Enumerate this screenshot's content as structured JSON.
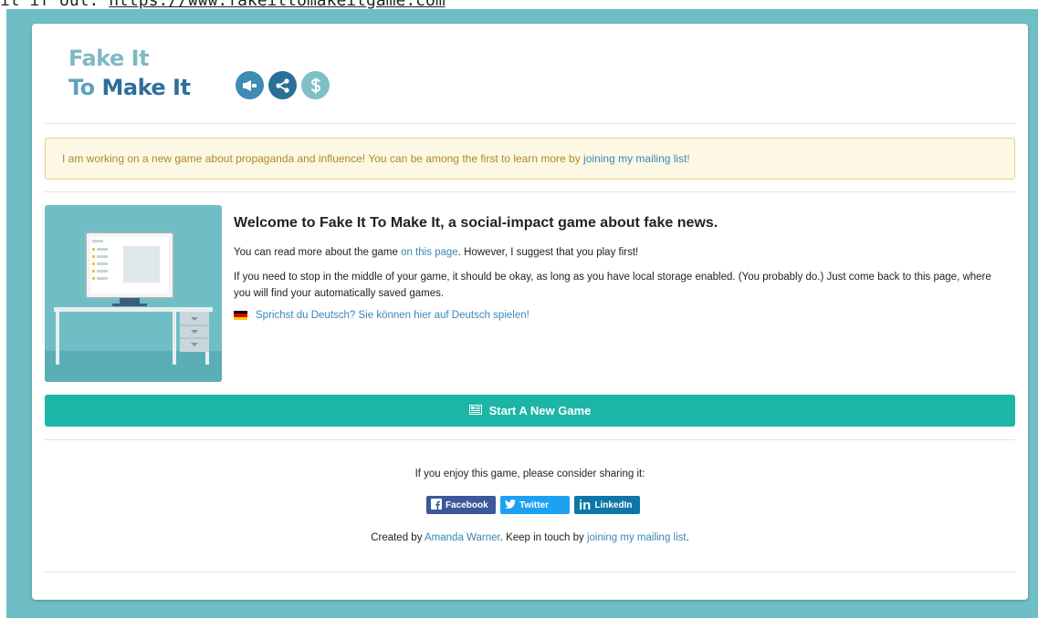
{
  "top_line": {
    "prefix": "it if out:",
    "url": "https://www.fakeittomakeitgame.com"
  },
  "logo": {
    "line1": "Fake It",
    "line2_a": "To ",
    "line2_b": "Make It"
  },
  "header_icons": [
    "megaphone-icon",
    "share-icon",
    "dollar-icon"
  ],
  "notice": {
    "text": "I am working on a new game about propaganda and influence! You can be among the first to learn more by ",
    "link": "joining my mailing list",
    "suffix": "!"
  },
  "intro": {
    "title": "Welcome to Fake It To Make It, a social-impact game about fake news.",
    "p1_before": "You can read more about the game ",
    "p1_link": "on this page",
    "p1_after": ". However, I suggest that you play first!",
    "p2": "If you need to stop in the middle of your game, it should be okay, as long as you have local storage enabled. (You probably do.) Just come back to this page, where you will find your automatically saved games.",
    "german_link": "Sprichst du Deutsch? Sie können hier auf Deutsch spielen!"
  },
  "start_button": {
    "label": "Start A New Game",
    "icon": "newspaper-icon"
  },
  "share": {
    "text": "If you enjoy this game, please consider sharing it:",
    "facebook": "Facebook",
    "twitter": "Twitter",
    "linkedin": "LinkedIn"
  },
  "credits": {
    "before": "Created by ",
    "author": "Amanda Warner",
    "middle": ". Keep in touch by ",
    "link": "joining my mailing list",
    "after": "."
  },
  "colors": {
    "background_teal": "#6fbec6",
    "start_button": "#1cb5a6",
    "link": "#3a86b8",
    "notice_bg": "#fcf8e3",
    "notice_text": "#b0882a"
  }
}
